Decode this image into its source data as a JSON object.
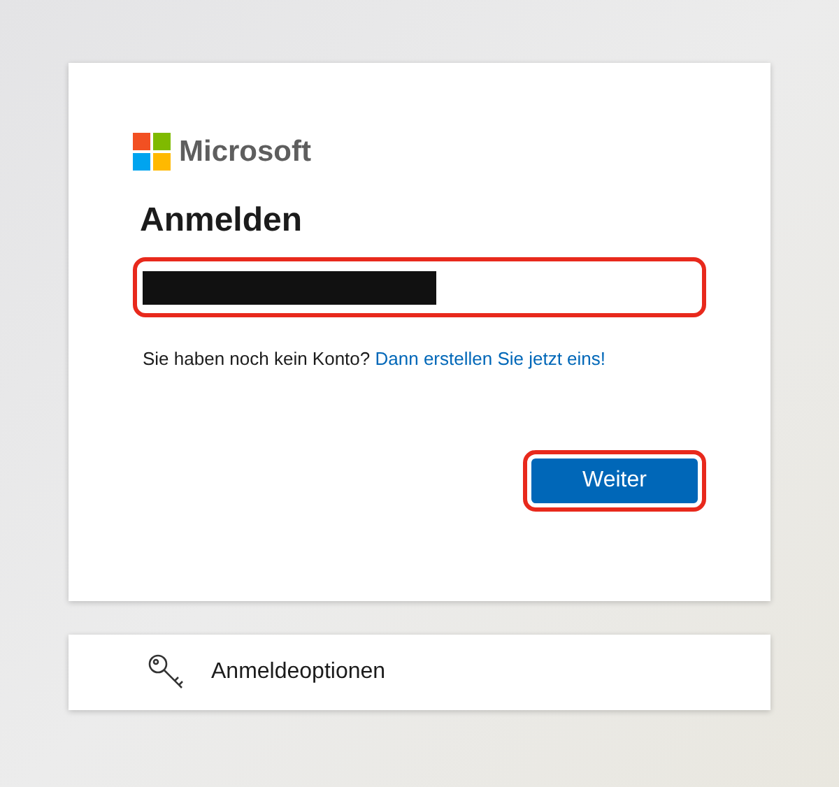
{
  "card": {
    "logo_text": "Microsoft",
    "title": "Anmelden",
    "email_field": {
      "redacted": true,
      "highlighted": true
    },
    "signup_prompt": "Sie haben noch kein Konto? ",
    "signup_link": "Dann erstellen Sie jetzt eins!",
    "next_button": {
      "label": "Weiter",
      "highlighted": true
    }
  },
  "options_card": {
    "label": "Anmeldeoptionen"
  }
}
